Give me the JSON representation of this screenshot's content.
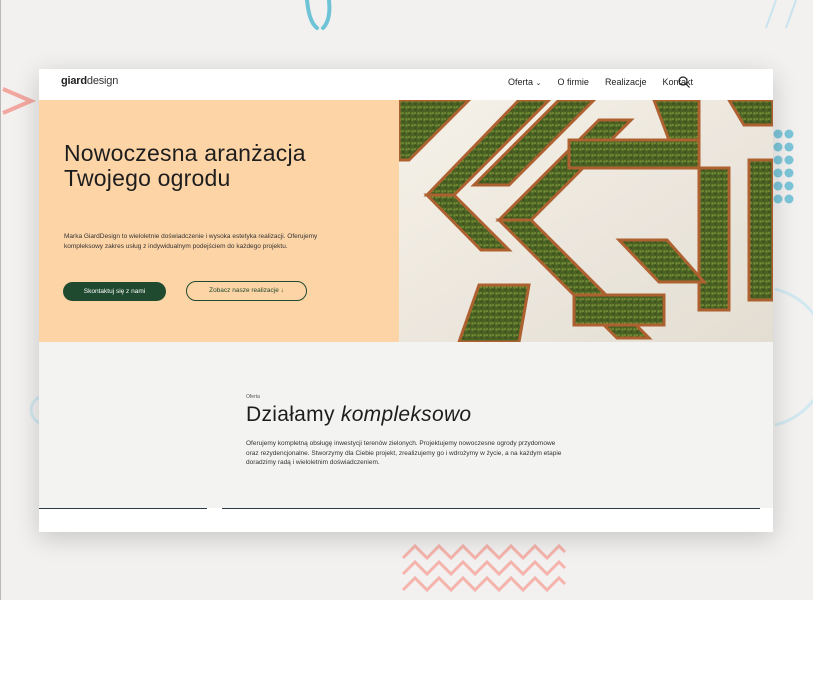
{
  "site": {
    "logo_bold": "giard",
    "logo_light": "design"
  },
  "nav": {
    "items": [
      {
        "label": "Oferta",
        "has_dropdown": true
      },
      {
        "label": "O firmie"
      },
      {
        "label": "Realizacje"
      },
      {
        "label": "Kontakt"
      }
    ],
    "dropdown_glyph": "⌄"
  },
  "hero": {
    "title": "Nowoczesna aranżacja Twojego ogrodu",
    "description": "Marka GiardDesign to wieloletnie doświadczenie i wysoka estetyka realizacji. Oferujemy kompleksowy zakres usług z indywidualnym podejściem do każdego projektu.",
    "primary_button": "Skontaktuj się z nami",
    "secondary_button": "Zobacz nasze realizacje",
    "secondary_icon": "↓",
    "prev_arrow": "←",
    "next_arrow": "→"
  },
  "offer": {
    "eyebrow": "Oferta",
    "title_regular": "Działamy ",
    "title_italic": "kompleksowo",
    "body": "Oferujemy kompletną obsługę inwestycji terenów zielonych. Projektujemy nowoczesne ogrody przydomowe oraz rezydencjonalne. Stworzymy dla Ciebie projekt, zrealizujemy go i wdrożymy w życie, a na każdym etapie doradzimy radą i wieloletnim doświadczeniem."
  },
  "colors": {
    "hero_bg": "#fdd4a6",
    "accent_green": "#1f4a2f",
    "section_bg": "#f3f3f1",
    "deco_blue": "#6fc3d6",
    "deco_pink": "#f2a7a0"
  },
  "icons": [
    "search-icon",
    "arrow-left-icon",
    "arrow-right-icon",
    "chevron-down-icon",
    "arrow-down-icon"
  ]
}
